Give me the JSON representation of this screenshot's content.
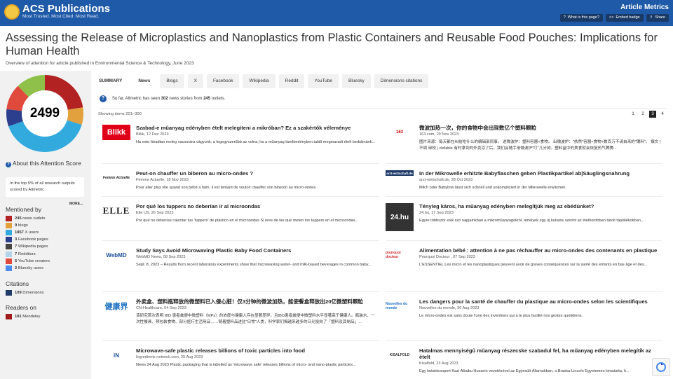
{
  "header": {
    "brand_name": "ACS Publications",
    "brand_tagline": "Most Trusted. Most Cited. Most Read.",
    "section_title": "Article Metrics",
    "buttons": [
      {
        "label": "What is this page?",
        "icon": "question-icon"
      },
      {
        "label": "Embed badge",
        "icon": "code-icon"
      },
      {
        "label": "Share",
        "icon": "share-icon"
      }
    ]
  },
  "article": {
    "title": "Assessing the Release of Microplastics and Nanoplastics from Plastic Containers and Reusable Food Pouches: Implications for Human Health",
    "subtitle": "Overview of attention for article published in Environmental Science & Technology, June 2023"
  },
  "sidebar": {
    "score": "2499",
    "about_label": "About this Attention Score",
    "top5_text": "In the top 5% of all research outputs scored by Altmetric",
    "more_label": "MORE...",
    "mentioned_by_label": "Mentioned by",
    "mentioned_by": [
      {
        "count": "245",
        "label": "news outlets",
        "color": "#b22222"
      },
      {
        "count": "9",
        "label": "blogs",
        "color": "#e2a13c"
      },
      {
        "count": "1857",
        "label": "X users",
        "color": "#33aadd"
      },
      {
        "count": "3",
        "label": "Facebook pages",
        "color": "#2b3f8e"
      },
      {
        "count": "7",
        "label": "Wikipedia pages",
        "color": "#444444"
      },
      {
        "count": "7",
        "label": "Redditors",
        "color": "#b3d3e8"
      },
      {
        "count": "6",
        "label": "YouTube creators",
        "color": "#df4a3c"
      },
      {
        "count": "2",
        "label": "Bluesky users",
        "color": "#4a8cf0"
      }
    ],
    "citations_label": "Citations",
    "citations": [
      {
        "count": "109",
        "label": "Dimensions",
        "color": "#1f3b6a"
      }
    ],
    "readers_label": "Readers on",
    "readers": [
      {
        "count": "181",
        "label": "Mendeley",
        "color": "#a01c1c"
      }
    ]
  },
  "tabs": [
    "SUMMARY",
    "News",
    "Blogs",
    "X",
    "Facebook",
    "Wikipedia",
    "Reddit",
    "YouTube",
    "Bluesky",
    "Dimensions citations"
  ],
  "active_tab": "News",
  "news_info": {
    "prefix": "So far, Altmetric has seen",
    "count": "302",
    "middle": "news stories from",
    "outlets": "245",
    "suffix": "outlets."
  },
  "showing": "Showing items 201–300",
  "pages": [
    "1",
    "2",
    "3",
    "4"
  ],
  "current_page": "3",
  "news_left": [
    {
      "logo": "Blikk",
      "title": "Szabad-e műanyag edényben ételt melegíteni a mikróban? Ez a szakértők véleménye",
      "source": "Blikk, 12 Dec 2023",
      "summary": "Ha este fáradtan meleg vacsorára vágyunk, a legegyszerűbb az volna, ha a műanyag tárolóedényben talált megmaradt ételt bedobnánk..."
    },
    {
      "logo": "Femme Actuelle",
      "title": "Peut-on chauffer un biberon au micro-ondes ?",
      "source": "Femme Actuelle, 18 Nov 2023",
      "summary": "Pour aller plus vite quand son bébé a faim, il est tentant de vouloir chauffer son biberon au micro-ondes."
    },
    {
      "logo": "ELLE",
      "title": "Por qué los tuppers no deberían ir al microondas",
      "source": "Elle US, 26 Sep 2023",
      "summary": "Por qué no deberías calentar tus 'tuppers' de plástico en el microondas Si eres de las que meten los tuppers en el microondas..."
    },
    {
      "logo": "WebMD",
      "title": "Study Says Avoid Microwaving Plastic Baby Food Containers",
      "source": "WebMD News, 08 Sep 2023",
      "summary": "Sept. 8, 2023 – Results from recent laboratory experiments show that microwaving water- and milk-based beverages in common baby..."
    },
    {
      "logo": "健康界",
      "title": "外卖盒、塑料瓶释放的微塑料已入侵心脏！仅3分钟的微波加热，能使餐盒释放出20亿微塑料颗粒",
      "source": "CN-Healthcare, 04 Sep 2023",
      "summary": "该研究首次表明 IBD 患者粪便中微塑料（MPs）的浓度与健康人存在显著差异，且IBD患者粪便中微塑料水平显著高于健康人。瓶装水、一次性餐具、预包装食物、部分医疗生活用品……随着塑料品进驻\"日常\"人类，科学家们揭越来越多的日光投向了「塑料及其制品」..."
    },
    {
      "logo": "iN",
      "title": "Microwave-safe plastic releases billions of toxic particles into food",
      "source": "Ingredients network.com, 25 Aug 2023",
      "summary": "News 24 Aug 2023 Plastic packaging that is labelled as 'microwave safe' releases billions of micro- and nano-plastic particles..."
    }
  ],
  "news_right": [
    {
      "logo": "163",
      "title": "微波加热一次，你的食物中会出现数亿个塑料颗粒",
      "source": "163.com, 29 Nov 2023",
      "summary": "图片来源：每天都在纠结吃什么的编辑部同事。 进微波炉：塑料容器+食物。 出微波炉：\"依然\"容器+食物+数百万不请自来的\"镶料\"。 撰文 | 不周 审校 | clefable 有时拿到的外卖凉了后。我们会随手用微波炉\"叮\"几分钟。塑料盒中的美食就会恢复热气腾腾..."
    },
    {
      "logo": "arzt-wirtschaft.de",
      "title": "In der Mikrowelle erhitzte Babyflaschen geben Plastikpartikel ab|Säuglingsnahrung",
      "source": "arzt-wirtschaft.de, 28 Oct 2023",
      "summary": "Milch oder Babybrei lässt sich schnell und unkompliziert in der Mikrowelle erwärmen."
    },
    {
      "logo": "24.hu",
      "title": "Tényleg káros, ha műanyag edényben melegítjük meg az ebédünket?",
      "source": "24.hu, 17 Sep 2023",
      "summary": "Egyre többször esik szó napjainkban a mikroműanyagokról, amelyek egy új kutatás szerint az ételhordóban tárolt táplálékokban..."
    },
    {
      "logo": "pourquoi docteur",
      "title": "Alimentation bébé : attention à ne pas réchauffer au micro-ondes des contenants en plastique",
      "source": "Pourquoi Docteur , 07 Sep 2023",
      "summary": "L'ESSENTIEL Les micro et les nanoplastiques peuvent avoir de graves conséquences sur la santé des enfants en bas âge et des..."
    },
    {
      "logo": "Nouvelles du monde",
      "title": "Les dangers pour la santé de chauffer du plastique au micro-ondes selon les scientifiques",
      "source": "Nouvelles du monde, 30 Aug 2023",
      "summary": "Le micro-ondes est sans doute l'une des inventions qui a le plus facilité nos gestes quotidiens."
    },
    {
      "logo": "KISALFOLD",
      "title": "Hatalmas mennyiségű műanyag részecske szabadul fel, ha műanyag edényben melegítik az ételt",
      "source": "Kisalfold, 23 Aug 2023",
      "summary": "Egy kutatócsoport Kazi Albabu Hussein vezetésével az Egyesült Államokban, a Braska-Lincoln Egyetemen kimutatta, h..."
    }
  ]
}
